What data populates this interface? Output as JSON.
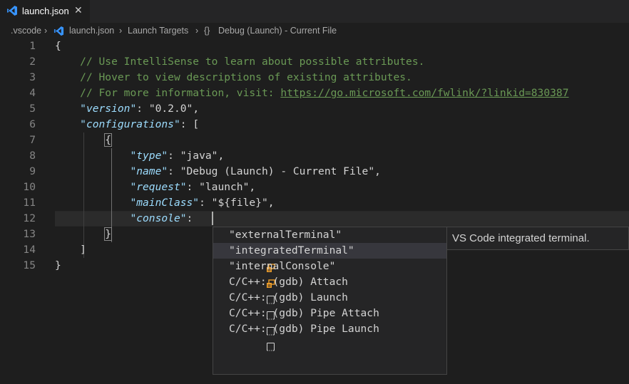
{
  "tab": {
    "filename": "launch.json",
    "close_glyph": "✕"
  },
  "breadcrumb": {
    "folder": ".vscode",
    "file": "launch.json",
    "section": "Launch Targets",
    "symbol_glyph": "{}",
    "entry": "Debug (Launch) - Current File",
    "separator": "›"
  },
  "lines": [
    {
      "n": "1"
    },
    {
      "n": "2"
    },
    {
      "n": "3"
    },
    {
      "n": "4"
    },
    {
      "n": "5"
    },
    {
      "n": "6"
    },
    {
      "n": "7"
    },
    {
      "n": "8"
    },
    {
      "n": "9"
    },
    {
      "n": "10"
    },
    {
      "n": "11"
    },
    {
      "n": "12"
    },
    {
      "n": "13"
    },
    {
      "n": "14"
    },
    {
      "n": "15"
    }
  ],
  "code": {
    "open_brace": "{",
    "comment1": "// Use IntelliSense to learn about possible attributes.",
    "comment2": "// Hover to view descriptions of existing attributes.",
    "comment3_prefix": "// For more information, visit: ",
    "comment3_link": "https://go.microsoft.com/fwlink/?linkid=830387",
    "version_key": "\"version\"",
    "version_val": "\"0.2.0\"",
    "configurations_key": "\"configurations\"",
    "open_bracket": "[",
    "obj_open": "{",
    "type_key": "\"type\"",
    "type_val": "\"java\"",
    "name_key": "\"name\"",
    "name_val": "\"Debug (Launch) - Current File\"",
    "request_key": "\"request\"",
    "request_val": "\"launch\"",
    "mainclass_key": "\"mainClass\"",
    "mainclass_val": "\"${file}\"",
    "console_key": "\"console\"",
    "obj_close": "}",
    "close_bracket": "]",
    "close_brace": "}"
  },
  "suggestions": [
    {
      "label": "\"externalTerminal\"",
      "icon": "enum-member-icon"
    },
    {
      "label": "\"integratedTerminal\"",
      "icon": "enum-member-icon",
      "selected": true
    },
    {
      "label": "\"internalConsole\"",
      "icon": "enum-member-icon"
    },
    {
      "label": "C/C++: (gdb) Attach",
      "icon": "snippet-icon"
    },
    {
      "label": "C/C++: (gdb) Launch",
      "icon": "snippet-icon"
    },
    {
      "label": "C/C++: (gdb) Pipe Attach",
      "icon": "snippet-icon"
    },
    {
      "label": "C/C++: (gdb) Pipe Launch",
      "icon": "snippet-icon"
    }
  ],
  "details": {
    "text": "VS Code integrated terminal."
  },
  "colors": {
    "accent_blue": "#3794ff",
    "enum_orange": "#ee9d28",
    "comment": "#6a9955",
    "key": "#9cdcfe",
    "string": "#ce9178"
  }
}
